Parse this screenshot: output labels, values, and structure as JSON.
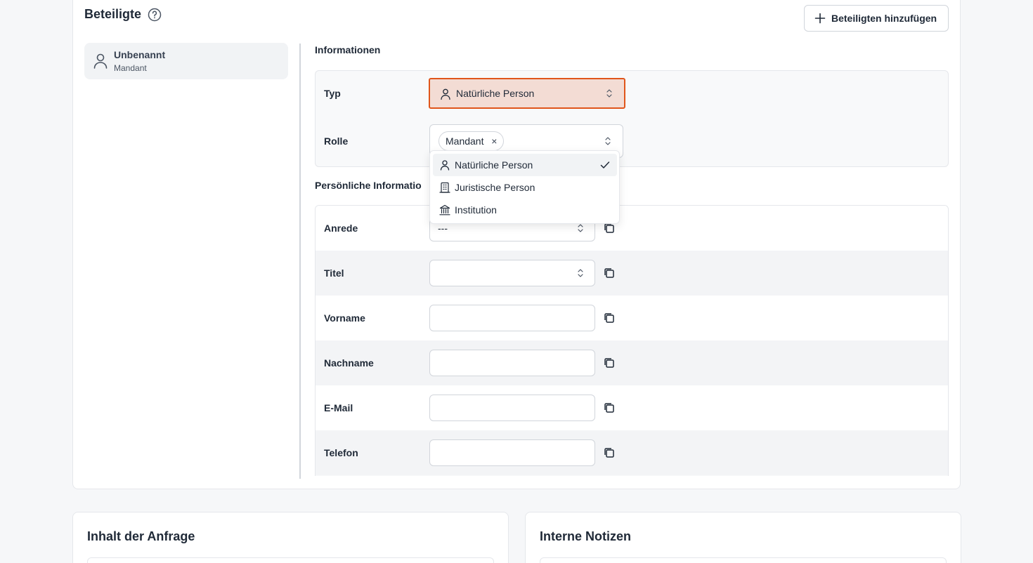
{
  "section": {
    "title": "Beteiligte",
    "add_button": "Beteiligten hinzufügen"
  },
  "participant": {
    "name": "Unbenannt",
    "role": "Mandant"
  },
  "informationen": {
    "title": "Informationen",
    "typ_label": "Typ",
    "typ_value": "Natürliche Person",
    "rolle_label": "Rolle",
    "rolle_chip": "Mandant",
    "chip_remove": "×"
  },
  "dropdown": {
    "options": [
      {
        "label": "Natürliche Person",
        "icon": "person-icon",
        "selected": true
      },
      {
        "label": "Juristische Person",
        "icon": "building-icon",
        "selected": false
      },
      {
        "label": "Institution",
        "icon": "institution-icon",
        "selected": false
      }
    ]
  },
  "personal": {
    "title": "Persönliche Informatio",
    "fields": [
      {
        "label": "Anrede",
        "value": "---",
        "kind": "select"
      },
      {
        "label": "Titel",
        "value": "",
        "kind": "select"
      },
      {
        "label": "Vorname",
        "value": "",
        "kind": "text"
      },
      {
        "label": "Nachname",
        "value": "",
        "kind": "text"
      },
      {
        "label": "E-Mail",
        "value": "",
        "kind": "text"
      },
      {
        "label": "Telefon",
        "value": "",
        "kind": "text"
      }
    ]
  },
  "bottom": {
    "left_title": "Inhalt der Anfrage",
    "right_title": "Interne Notizen"
  },
  "colors": {
    "accent": "#e0551a",
    "accent_bg": "#f3dcd4",
    "page_bg": "#f6f7f9"
  }
}
